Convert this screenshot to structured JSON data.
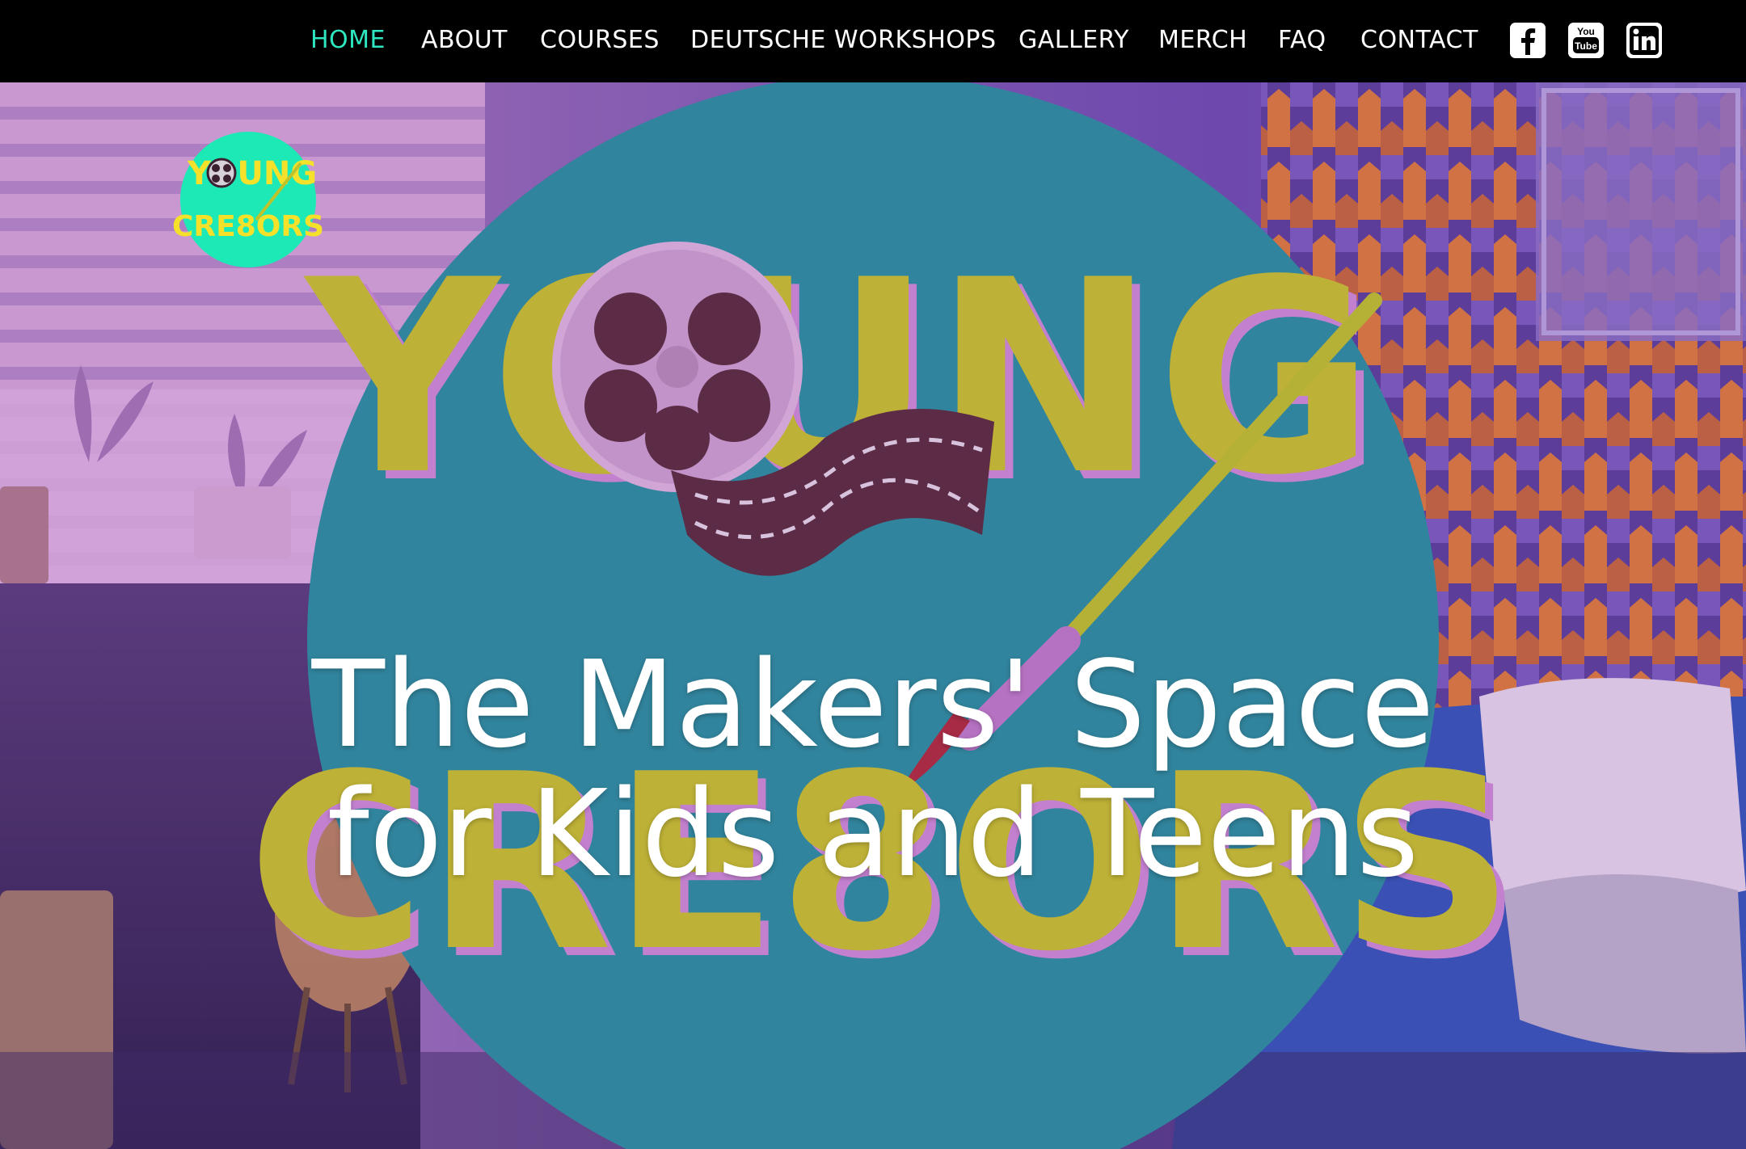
{
  "nav": {
    "items": [
      {
        "label": "HOME",
        "active": true
      },
      {
        "label": "ABOUT",
        "active": false
      },
      {
        "label": "COURSES",
        "active": false
      },
      {
        "label": "DEUTSCHE WORKSHOPS",
        "active": false
      },
      {
        "label": "GALLERY",
        "active": false
      },
      {
        "label": "MERCH",
        "active": false
      },
      {
        "label": "FAQ",
        "active": false
      },
      {
        "label": "CONTACT",
        "active": false
      }
    ],
    "social": [
      {
        "icon": "facebook-icon"
      },
      {
        "icon": "youtube-icon",
        "glyph_top": "You",
        "glyph_bottom": "Tube"
      },
      {
        "icon": "linkedin-icon",
        "glyph": "in"
      }
    ]
  },
  "logo": {
    "line1": "YOUNG",
    "line2": "CRE8ORS"
  },
  "hero": {
    "heading_line1": "The Makers' Space",
    "heading_line2": "for Kids and Teens",
    "big_logo_line1": "YOUNG",
    "big_logo_line2": "CRE8ORS"
  },
  "colors": {
    "accent": "#2ee6c0",
    "nav_bg": "#000000",
    "circle_teal": "#2a8f9e",
    "logo_yellow": "#c9c22a",
    "logo_pink": "#d08ad6",
    "small_logo_bg": "#1de9b6",
    "small_logo_text": "#f5e12a"
  }
}
